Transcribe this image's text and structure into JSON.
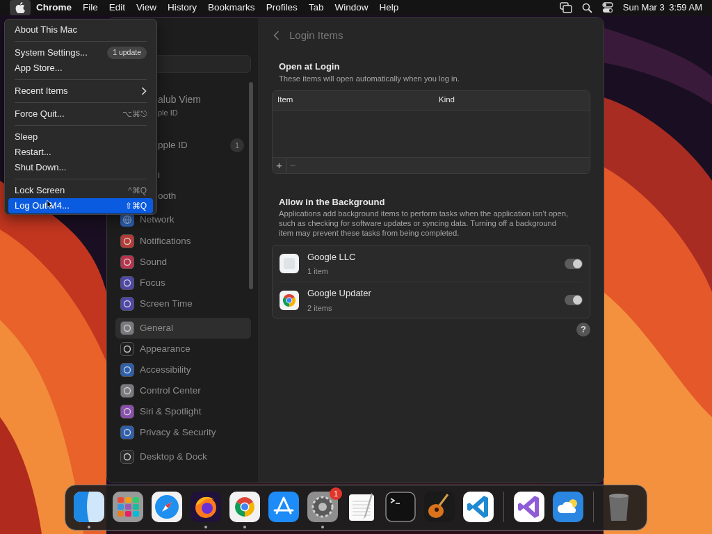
{
  "menu_bar": {
    "app": "Chrome",
    "menus": [
      "File",
      "Edit",
      "View",
      "History",
      "Bookmarks",
      "Profiles",
      "Tab",
      "Window",
      "Help"
    ],
    "apple_selected": true,
    "date": "Sun Mar 3",
    "time": "3:59 AM"
  },
  "apple_menu": {
    "items": [
      {
        "kind": "item",
        "label": "About This Mac",
        "selected": false
      },
      {
        "kind": "separator"
      },
      {
        "kind": "item",
        "label": "System Settings...",
        "badge": "1 update",
        "selected": false
      },
      {
        "kind": "item",
        "label": "App Store...",
        "selected": false
      },
      {
        "kind": "separator"
      },
      {
        "kind": "item",
        "label": "Recent Items",
        "submenu": true,
        "selected": false
      },
      {
        "kind": "separator"
      },
      {
        "kind": "item",
        "label": "Force Quit...",
        "shortcut": "⌥⌘⎋",
        "selected": false
      },
      {
        "kind": "separator"
      },
      {
        "kind": "item",
        "label": "Sleep",
        "selected": false
      },
      {
        "kind": "item",
        "label": "Restart...",
        "selected": false
      },
      {
        "kind": "item",
        "label": "Shut Down...",
        "selected": false
      },
      {
        "kind": "separator"
      },
      {
        "kind": "item",
        "label": "Lock Screen",
        "shortcut": "^⌘Q",
        "selected": false
      },
      {
        "kind": "item",
        "label": "Log Out M4...",
        "shortcut": "⇧⌘Q",
        "selected": true
      }
    ]
  },
  "sidebar": {
    "top": [
      {
        "kind": "profile",
        "title": "alub Viem",
        "subtitle": "ple ID"
      },
      {
        "kind": "row",
        "label": "pple ID",
        "badge": "1",
        "cut": true
      },
      {
        "kind": "row",
        "label": "i",
        "cut": true
      },
      {
        "kind": "row",
        "label": "ooth",
        "cut": true
      },
      {
        "kind": "row",
        "label": "Network",
        "cut": false,
        "color": "#2d5fae"
      }
    ],
    "groups": [
      [
        {
          "label": "Notifications",
          "color": "#b83a34",
          "selected": false
        },
        {
          "label": "Sound",
          "color": "#b8334b",
          "selected": false
        },
        {
          "label": "Focus",
          "color": "#4e46a8",
          "selected": false
        },
        {
          "label": "Screen Time",
          "color": "#4e46a8",
          "selected": false
        }
      ],
      [
        {
          "label": "General",
          "color": "#7a7a7e",
          "selected": true
        },
        {
          "label": "Appearance",
          "color": "#202020",
          "selected": false
        },
        {
          "label": "Accessibility",
          "color": "#2d5fae",
          "selected": false
        },
        {
          "label": "Control Center",
          "color": "#7a7a7e",
          "selected": false
        },
        {
          "label": "Siri & Spotlight",
          "color": "#8a4fae",
          "selected": false
        },
        {
          "label": "Privacy & Security",
          "color": "#2d5fae",
          "selected": false
        }
      ],
      [
        {
          "label": "Desktop & Dock",
          "color": "#2a2a2a",
          "selected": false
        }
      ]
    ]
  },
  "content": {
    "title": "Login Items",
    "open_at_login": {
      "heading": "Open at Login",
      "description": "These items will open automatically when you log in.",
      "columns": [
        "Item",
        "Kind"
      ],
      "add": "+",
      "remove": "−"
    },
    "background": {
      "heading": "Allow in the Background",
      "description": "Applications add background items to perform tasks when the application isn’t open, such as checking for software updates or syncing data. Turning off a background item may prevent these tasks from being completed.",
      "items": [
        {
          "kind": "blank",
          "name": "Google LLC",
          "detail": "1 item",
          "on": true
        },
        {
          "kind": "chrome",
          "name": "Google Updater",
          "detail": "2 items",
          "on": true
        }
      ]
    },
    "help": "?"
  },
  "dock": [
    {
      "kind": "finder",
      "running": true
    },
    {
      "kind": "launchpad",
      "running": false
    },
    {
      "kind": "safari",
      "running": false
    },
    {
      "kind": "firefox",
      "running": true
    },
    {
      "kind": "chrome",
      "running": true
    },
    {
      "kind": "appstore",
      "running": false
    },
    {
      "kind": "settings",
      "running": true,
      "badge": "1"
    },
    {
      "kind": "textedit",
      "running": false
    },
    {
      "kind": "terminal",
      "running": false
    },
    {
      "kind": "garageband",
      "running": false
    },
    {
      "kind": "vscode",
      "running": false
    },
    {
      "kind": "separator"
    },
    {
      "kind": "vstudio",
      "running": false
    },
    {
      "kind": "weather",
      "running": false
    },
    {
      "kind": "separator"
    },
    {
      "kind": "trash",
      "running": false
    }
  ]
}
